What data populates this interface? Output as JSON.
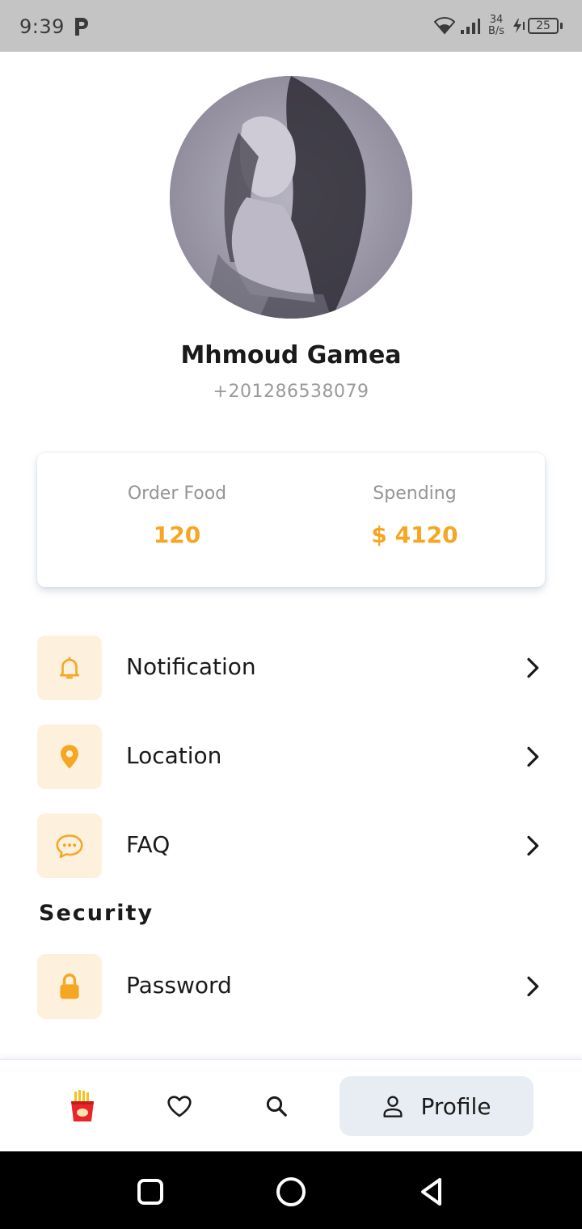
{
  "status_bar": {
    "time": "9:39",
    "speed_value": "34",
    "speed_unit": "B/s",
    "battery": "25"
  },
  "profile": {
    "name": "Mhmoud Gamea",
    "phone": "+201286538079"
  },
  "stats": {
    "order_label": "Order Food",
    "order_value": "120",
    "spending_label": "Spending",
    "spending_value": "$ 4120"
  },
  "menu": {
    "items": [
      {
        "label": "Notification",
        "icon": "bell-icon"
      },
      {
        "label": "Location",
        "icon": "location-pin-icon"
      },
      {
        "label": "FAQ",
        "icon": "chat-bubble-icon"
      }
    ],
    "security_title": "Security",
    "security_items": [
      {
        "label": "Password",
        "icon": "lock-icon"
      }
    ]
  },
  "bottom_nav": {
    "items": [
      {
        "icon": "fries-icon"
      },
      {
        "icon": "heart-icon"
      },
      {
        "icon": "search-icon"
      },
      {
        "icon": "person-icon",
        "label": "Profile",
        "active": true
      }
    ]
  },
  "colors": {
    "accent": "#f5a623",
    "icon_bg": "#fdf0dd",
    "nav_active_bg": "#e8edf4"
  }
}
